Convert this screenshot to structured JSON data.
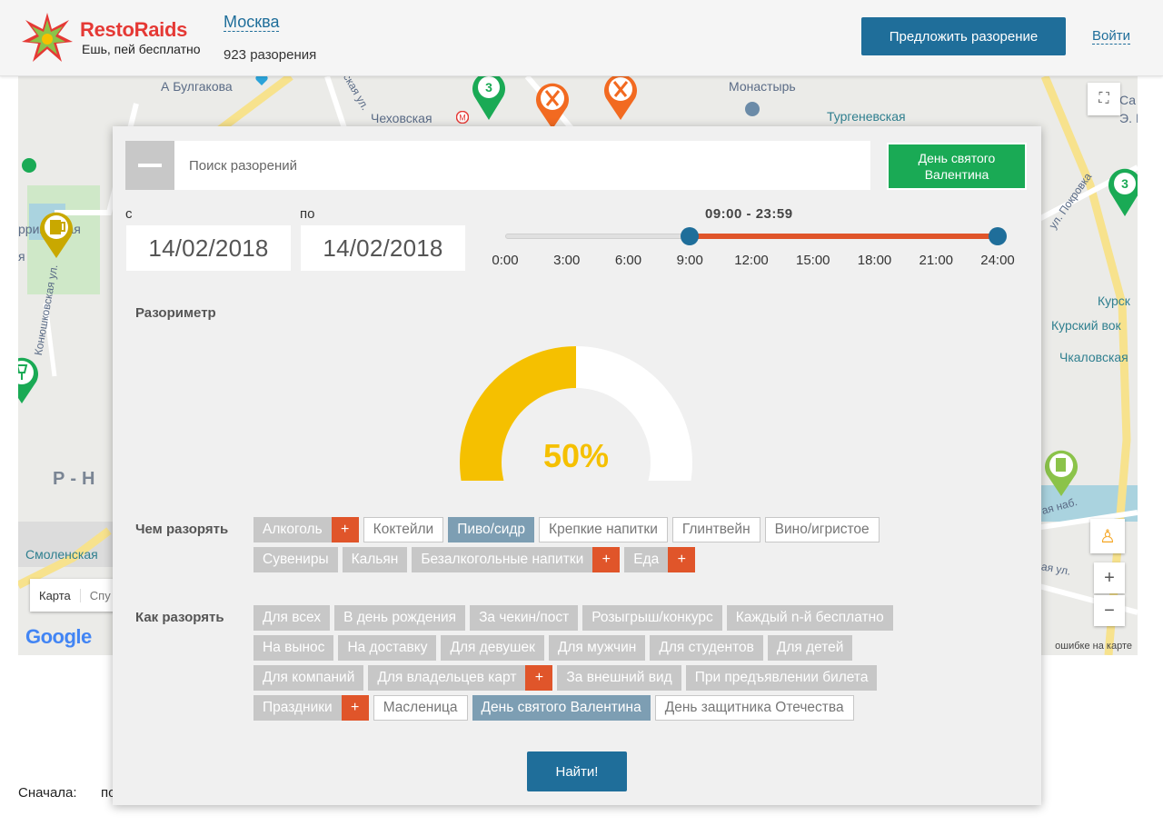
{
  "header": {
    "brand": "RestoRaids",
    "tagline": "Ешь, пей бесплатно",
    "city": "Москва",
    "raids_count": "923 разорения",
    "propose_button": "Предложить разорение",
    "login_link": "Войти"
  },
  "map": {
    "labels": {
      "bulgakov": "А Булгакова",
      "chekhovskaya": "Чеховская",
      "monastery": "Монастырь",
      "turgenevskaya": "Тургеневская",
      "pokrovka": "ул. Покровка",
      "kursk1": "Курск",
      "kursk2": "Курский вок",
      "chkalovskaya": "Чкаловская",
      "konyushkovskaya": "Конюшковская ул.",
      "district": "Р-Н",
      "smolenskaya": "Смоленская",
      "nab": "ая наб.",
      "ul1": "ая ул.",
      "ul2": "ская ул.",
      "sa": "Са",
      "e": "Э. I",
      "barr": "ррикадная",
      "ya": "я"
    },
    "pins": [
      {
        "icon": "number-pin-icon",
        "text": "3",
        "color": "#1aaa55"
      },
      {
        "icon": "restaurant-pin-icon",
        "color": "#f26a21"
      },
      {
        "icon": "restaurant-pin-icon",
        "color": "#f26a21"
      },
      {
        "icon": "beer-pin-icon",
        "color": "#c9a800"
      },
      {
        "icon": "wine-pin-icon",
        "color": "#1aaa55"
      },
      {
        "icon": "number-pin-icon",
        "text": "3",
        "color": "#1aaa55"
      },
      {
        "icon": "drink-pin-icon",
        "color": "#8bc34a"
      }
    ],
    "map_type": "Карта",
    "map_type_cut": "Спу",
    "google": "Google",
    "footer": "ошибке на карте",
    "zoom_in": "+",
    "zoom_out": "−"
  },
  "sort": {
    "label": "Сначала:",
    "value_cut": "по"
  },
  "panel": {
    "search_placeholder": "Поиск разорений",
    "holiday_button": "День святого Валентина",
    "date_from_label": "с",
    "date_from": "14/02/2018",
    "date_to_label": "по",
    "date_to": "14/02/2018",
    "time_range": "09:00 - 23:59",
    "time_ticks": [
      "0:00",
      "3:00",
      "6:00",
      "9:00",
      "12:00",
      "15:00",
      "18:00",
      "21:00",
      "24:00"
    ],
    "time_start_fraction": 0.375,
    "time_end_fraction": 1.0,
    "meter_label": "Разориметр",
    "meter_value": "50%",
    "meter_fraction": 0.5,
    "meter_color": "#f5c000",
    "what_label": "Чем разорять",
    "what_tags": [
      {
        "label": "Алкоголь",
        "style": "grey",
        "plus": true
      },
      {
        "label": "Коктейли",
        "style": "outline",
        "plus": false
      },
      {
        "label": "Пиво/сидр",
        "style": "active",
        "plus": false
      },
      {
        "label": "Крепкие напитки",
        "style": "outline",
        "plus": false
      },
      {
        "label": "Глинтвейн",
        "style": "outline",
        "plus": false
      },
      {
        "label": "Вино/игристое",
        "style": "outline",
        "plus": false
      },
      {
        "label": "Сувениры",
        "style": "grey",
        "plus": false
      },
      {
        "label": "Кальян",
        "style": "grey",
        "plus": false
      },
      {
        "label": "Безалкогольные напитки",
        "style": "grey",
        "plus": true
      },
      {
        "label": "Еда",
        "style": "grey",
        "plus": true
      }
    ],
    "how_label": "Как разорять",
    "how_tags": [
      {
        "label": "Для всех",
        "style": "grey",
        "plus": false
      },
      {
        "label": "В день рождения",
        "style": "grey",
        "plus": false
      },
      {
        "label": "За чекин/пост",
        "style": "grey",
        "plus": false
      },
      {
        "label": "Розыгрыш/конкурс",
        "style": "grey",
        "plus": false
      },
      {
        "label": "Каждый n-й бесплатно",
        "style": "grey",
        "plus": false
      },
      {
        "label": "На вынос",
        "style": "grey",
        "plus": false
      },
      {
        "label": "На доставку",
        "style": "grey",
        "plus": false
      },
      {
        "label": "Для девушек",
        "style": "grey",
        "plus": false
      },
      {
        "label": "Для мужчин",
        "style": "grey",
        "plus": false
      },
      {
        "label": "Для студентов",
        "style": "grey",
        "plus": false
      },
      {
        "label": "Для детей",
        "style": "grey",
        "plus": false
      },
      {
        "label": "Для компаний",
        "style": "grey",
        "plus": false
      },
      {
        "label": "Для владельцев карт",
        "style": "grey",
        "plus": true
      },
      {
        "label": "За внешний вид",
        "style": "grey",
        "plus": false
      },
      {
        "label": "При предъявлении билета",
        "style": "grey",
        "plus": false
      },
      {
        "label": "Праздники",
        "style": "grey",
        "plus": true
      },
      {
        "label": "Масленица",
        "style": "outline",
        "plus": false
      },
      {
        "label": "День святого Валентина",
        "style": "active",
        "plus": false
      },
      {
        "label": "День защитника Отечества",
        "style": "outline",
        "plus": false
      }
    ],
    "find_button": "Найти!"
  },
  "colors": {
    "primary": "#1f6e9a",
    "accent": "#e0552a",
    "green": "#1aaa55",
    "brand_red": "#e53935"
  }
}
